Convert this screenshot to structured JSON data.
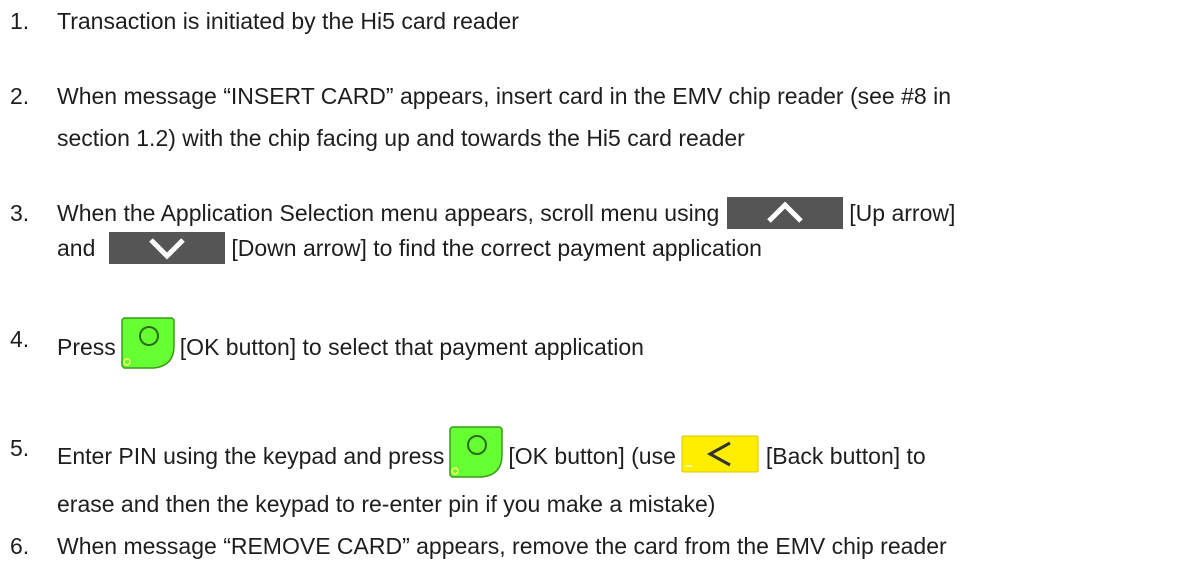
{
  "steps": [
    {
      "number": "1.",
      "text": "Transaction is initiated by the Hi5 card reader"
    },
    {
      "number": "2.",
      "line1": "When message “INSERT CARD” appears, insert card in the EMV chip reader (see #8 in",
      "line2": "section 1.2)  with the chip facing up and towards the Hi5 card reader"
    },
    {
      "number": "3.",
      "line1_before": "When the Application Selection menu appears, scroll menu using",
      "line1_after": "[Up arrow]",
      "line2_before": "and",
      "line2_after": "[Down arrow] to find the correct payment application"
    },
    {
      "number": "4.",
      "before": "Press",
      "after": "[OK button] to select that payment application"
    },
    {
      "number": "5.",
      "before": "Enter PIN using the keypad and press",
      "middle": "[OK button] (use",
      "after": "[Back button] to",
      "line2": "erase and then the keypad to re-enter pin if you make a mistake)"
    },
    {
      "number": "6.",
      "text": "When message “REMOVE CARD” appears, remove the card from the EMV chip reader"
    }
  ],
  "icons": {
    "up": "up-arrow-key-icon",
    "down": "down-arrow-key-icon",
    "ok": "ok-button-icon",
    "back": "back-button-icon"
  },
  "colors": {
    "text": "#1e1e1e",
    "arrow_key_bg": "#555555",
    "ok_green": "#66ff33",
    "back_yellow": "#ffee00"
  }
}
